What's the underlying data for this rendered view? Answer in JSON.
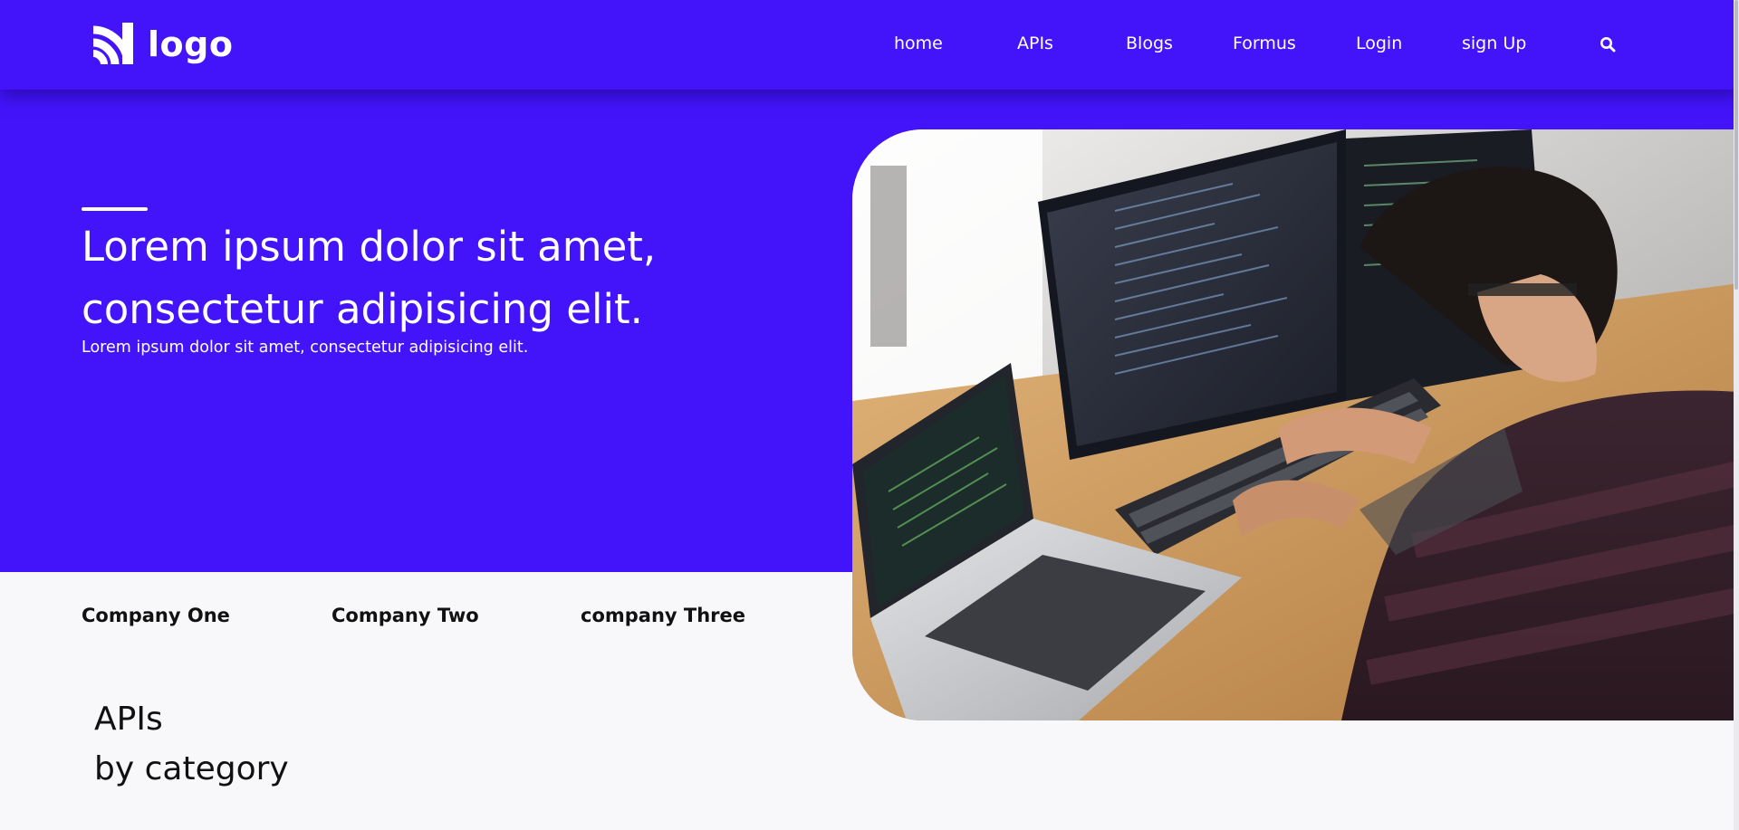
{
  "header": {
    "logo_text": "logo",
    "nav": [
      {
        "label": "home"
      },
      {
        "label": "APIs"
      },
      {
        "label": "Blogs"
      },
      {
        "label": "Formus"
      },
      {
        "label": "Login"
      },
      {
        "label": "sign Up"
      }
    ],
    "search_icon": "search-icon"
  },
  "hero": {
    "title_line1": "Lorem ipsum dolor sit amet,",
    "title_line2": "consectetur adipisicing elit.",
    "subtitle": "Lorem ipsum dolor sit amet, consectetur adipisicing elit.",
    "image": "developer-at-workstation-photo"
  },
  "companies": [
    {
      "label": "Company One"
    },
    {
      "label": "Company Two"
    },
    {
      "label": "company Three"
    }
  ],
  "apis_section": {
    "line1": "APIs",
    "line2": "by category"
  },
  "colors": {
    "brand": "#4314fa",
    "background": "#f8f8fa",
    "text_dark": "#111111",
    "text_light": "#ffffff"
  }
}
